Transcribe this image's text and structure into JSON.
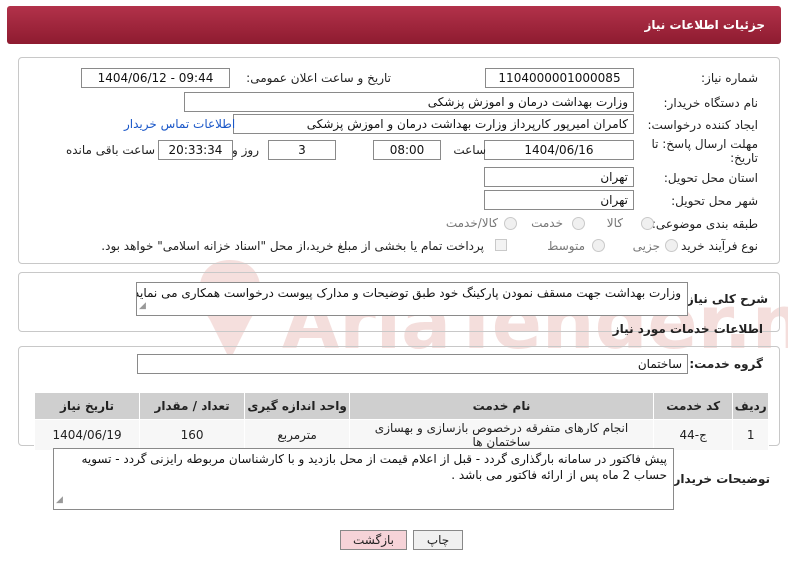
{
  "page_title": "جزئیات اطلاعات نیاز",
  "fields": {
    "need_number": {
      "label": "شماره نیاز:",
      "value": "1104000001000085"
    },
    "announce_datetime": {
      "label": "تاریخ و ساعت اعلان عمومی:",
      "value": "1404/06/12 - 09:44"
    },
    "buyer_org": {
      "label": "نام دستگاه خریدار:",
      "value": "وزارت بهداشت  درمان و اموزش پزشکی"
    },
    "requester": {
      "label": "ایجاد کننده درخواست:",
      "value": "کامران امیرپور کارپرداز وزارت بهداشت  درمان و اموزش پزشکی",
      "link": "اطلاعات تماس خریدار"
    },
    "deadline": {
      "label_1": "مهلت ارسال پاسخ: تا",
      "label_2": "تاریخ:",
      "date": "1404/06/16",
      "time_label": "ساعت",
      "time": "08:00",
      "days": "3",
      "days_label": "روز و",
      "remaining": "20:33:34",
      "remaining_label": "ساعت باقی مانده"
    },
    "province": {
      "label": "استان محل تحویل:",
      "value": "تهران"
    },
    "city": {
      "label": "شهر محل تحویل:",
      "value": "تهران"
    },
    "category": {
      "label": "طبقه بندی موضوعی:",
      "options": [
        "کالا",
        "خدمت",
        "کالا/خدمت"
      ]
    },
    "purchase_type": {
      "label": "نوع فرآیند خرید :",
      "options": [
        "جزیی",
        "متوسط"
      ],
      "note": "پرداخت تمام یا بخشی از مبلغ خرید،از محل \"اسناد خزانه اسلامی\" خواهد بود."
    }
  },
  "description": {
    "label": "شرح کلی نیاز:",
    "value": "وزارت بهداشت جهت مسقف نمودن پارکینگ خود طبق توضیحات و مدارک پیوست درخواست همکاری می نماید ."
  },
  "services": {
    "heading": "اطلاعات خدمات مورد نیاز",
    "group_label": "گروه خدمت:",
    "group_value": "ساختمان",
    "columns": [
      "ردیف",
      "کد خدمت",
      "نام خدمت",
      "واحد اندازه گیری",
      "تعداد / مقدار",
      "تاریخ نیاز"
    ],
    "rows": [
      [
        "1",
        "ج-44",
        "انجام کارهای متفرقه درخصوص بازسازی و بهسازی ساختمان ها",
        "مترمربع",
        "160",
        "1404/06/19"
      ]
    ]
  },
  "buyer_notes": {
    "label": "توضیحات خریدار:",
    "value": "پیش فاکتور در سامانه بارگذاری گردد - قبل از اعلام قیمت از محل بازدید و با کارشناسان مربوطه رایزنی گردد - تسویه حساب 2 ماه پس از ارائه فاکتور می باشد ."
  },
  "buttons": {
    "print": "چاپ",
    "back": "بازگشت"
  },
  "watermark": "AriaTender.net",
  "colors": {
    "header": "#9e2238",
    "link": "#1a57c8",
    "back_button_bg": "#f6d3d8"
  }
}
